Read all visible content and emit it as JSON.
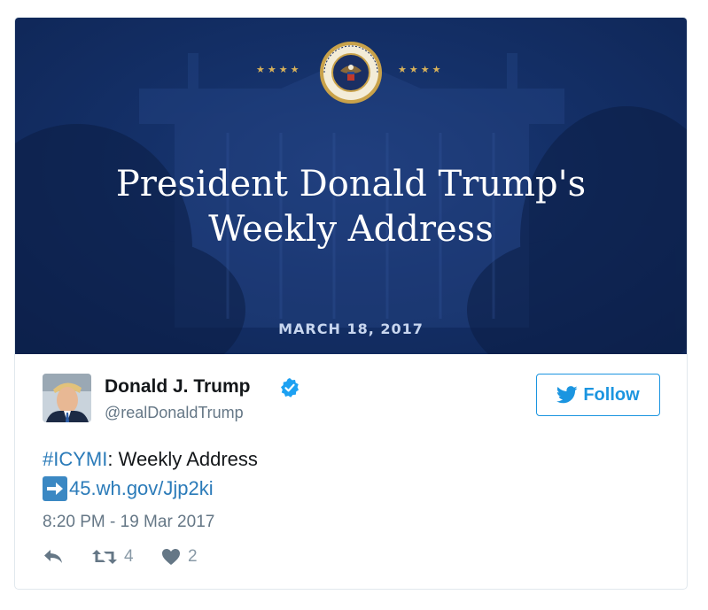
{
  "banner": {
    "headline_line1": "President Donald Trump's",
    "headline_line2": "Weekly Address",
    "date": "MARCH 18, 2017",
    "stars_left": "★★★★",
    "stars_right": "★★★★",
    "seal_icon": "presidential-seal",
    "colors": {
      "background": "#143068",
      "text": "#ffffff",
      "stars": "#d9b25a"
    }
  },
  "author": {
    "name": "Donald J. Trump",
    "handle": "@realDonaldTrump",
    "verified": true,
    "avatar": "profile-photo"
  },
  "follow_button": {
    "label": "Follow",
    "icon": "twitter-bird-icon",
    "color": "#1b95e0"
  },
  "tweet": {
    "hashtag": "#ICYMI",
    "text_after_hashtag": ": Weekly Address",
    "link_icon": "right-arrow-emoji",
    "link": "45.wh.gov/Jjp2ki",
    "timestamp": "8:20 PM - 19 Mar 2017"
  },
  "actions": {
    "reply_icon": "reply-icon",
    "retweet_icon": "retweet-icon",
    "retweet_count": "4",
    "like_icon": "heart-icon",
    "like_count": "2"
  }
}
